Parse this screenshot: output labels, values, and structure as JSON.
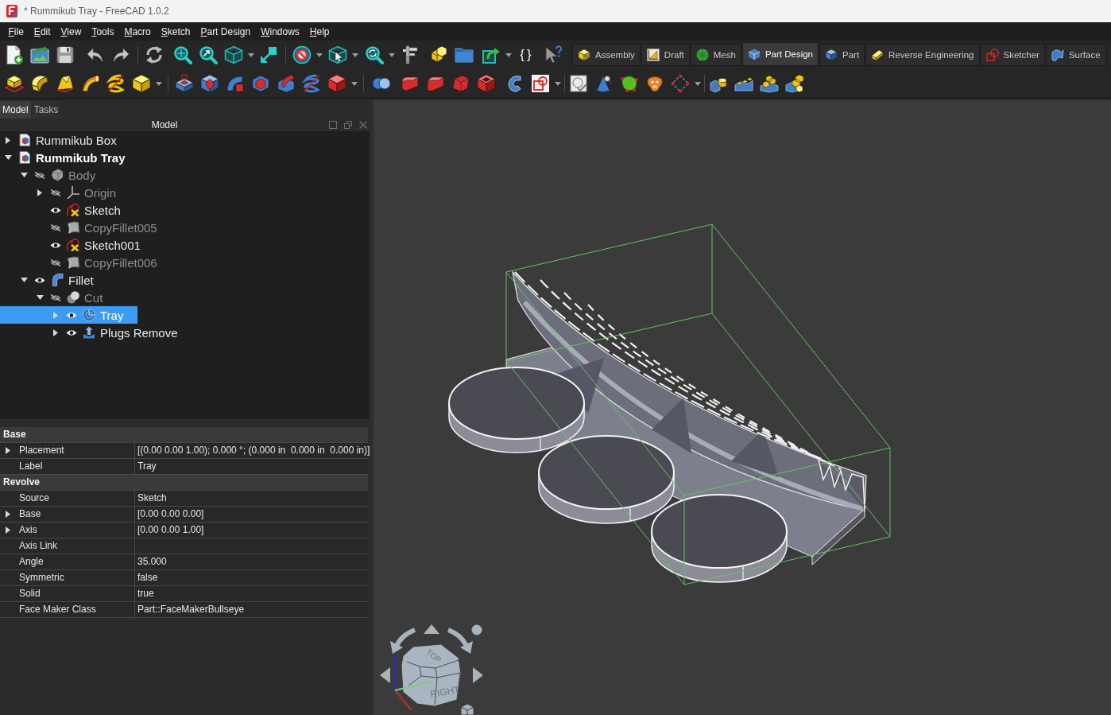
{
  "window": {
    "title": "* Rummikub Tray - FreeCAD 1.0.2"
  },
  "menu_bar": {
    "items": [
      "File",
      "Edit",
      "View",
      "Tools",
      "Macro",
      "Sketch",
      "Part Design",
      "Windows",
      "Help"
    ]
  },
  "toolbar": {
    "braces_button": "{}"
  },
  "workbench_tabs": [
    {
      "label": "Assembly",
      "kind": "assembly",
      "selected": false
    },
    {
      "label": "Draft",
      "kind": "draft",
      "selected": false
    },
    {
      "label": "Mesh",
      "kind": "mesh",
      "selected": false
    },
    {
      "label": "Part Design",
      "kind": "part_design",
      "selected": true
    },
    {
      "label": "Part",
      "kind": "part",
      "selected": false
    },
    {
      "label": "Reverse Engineering",
      "kind": "reverse_engineering",
      "selected": false
    },
    {
      "label": "Sketcher",
      "kind": "sketcher",
      "selected": false
    },
    {
      "label": "Surface",
      "kind": "surface",
      "selected": false
    }
  ],
  "side_panel": {
    "tabs": [
      {
        "label": "Model",
        "selected": true
      },
      {
        "label": "Tasks",
        "selected": false
      }
    ],
    "title": "Model",
    "tree": [
      {
        "label": "Rummikub Box",
        "kind": "document",
        "active": false,
        "expanded": false,
        "selected": false
      },
      {
        "label": "Rummikub Tray",
        "kind": "document",
        "active": true,
        "expanded": true,
        "selected": false,
        "children": [
          {
            "label": "Body",
            "kind": "body",
            "visible": false,
            "expanded": true,
            "selected": false,
            "children": [
              {
                "label": "Origin",
                "kind": "origin",
                "visible": false,
                "expanded": false,
                "selected": false
              },
              {
                "label": "Sketch",
                "kind": "sketch",
                "visible": true,
                "selected": false
              },
              {
                "label": "CopyFillet005",
                "kind": "shape_binder",
                "visible": false,
                "selected": false
              },
              {
                "label": "Sketch001",
                "kind": "sketch",
                "visible": true,
                "selected": false
              },
              {
                "label": "CopyFillet006",
                "kind": "shape_binder",
                "visible": false,
                "selected": false
              }
            ]
          },
          {
            "label": "Fillet",
            "kind": "fillet",
            "visible": true,
            "expanded": true,
            "selected": false,
            "children": [
              {
                "label": "Cut",
                "kind": "boolean",
                "visible": false,
                "expanded": true,
                "selected": false,
                "children": [
                  {
                    "label": "Tray",
                    "kind": "revolution",
                    "visible": true,
                    "expanded": false,
                    "selected": true
                  },
                  {
                    "label": "Plugs Remove",
                    "kind": "pocket",
                    "visible": true,
                    "expanded": false,
                    "selected": false
                  }
                ]
              }
            ]
          }
        ]
      }
    ]
  },
  "property_view": {
    "groups": [
      {
        "name": "Base",
        "rows": [
          {
            "name": "Placement",
            "value": "[(0.00 0.00 1.00); 0.000 °; (0.000 in  0.000 in  0.000 in)]",
            "expanded": false
          },
          {
            "name": "Label",
            "value": "Tray"
          }
        ]
      },
      {
        "name": "Revolve",
        "rows": [
          {
            "name": "Source",
            "value": "Sketch"
          },
          {
            "name": "Base",
            "value": "[0.00 0.00 0.00]",
            "expanded": false
          },
          {
            "name": "Axis",
            "value": "[0.00 0.00 1.00]",
            "expanded": false
          },
          {
            "name": "Axis Link"
          },
          {
            "name": "Angle",
            "value": "35.000"
          },
          {
            "name": "Symmetric",
            "value": "false"
          },
          {
            "name": "Solid",
            "value": "true"
          },
          {
            "name": "Face Maker Class",
            "value": "Part::FaceMakerBullseye"
          }
        ]
      }
    ]
  },
  "view_3d": {
    "nav_cube": {
      "face_labels": [
        "TOP",
        "RIGHT"
      ]
    }
  }
}
